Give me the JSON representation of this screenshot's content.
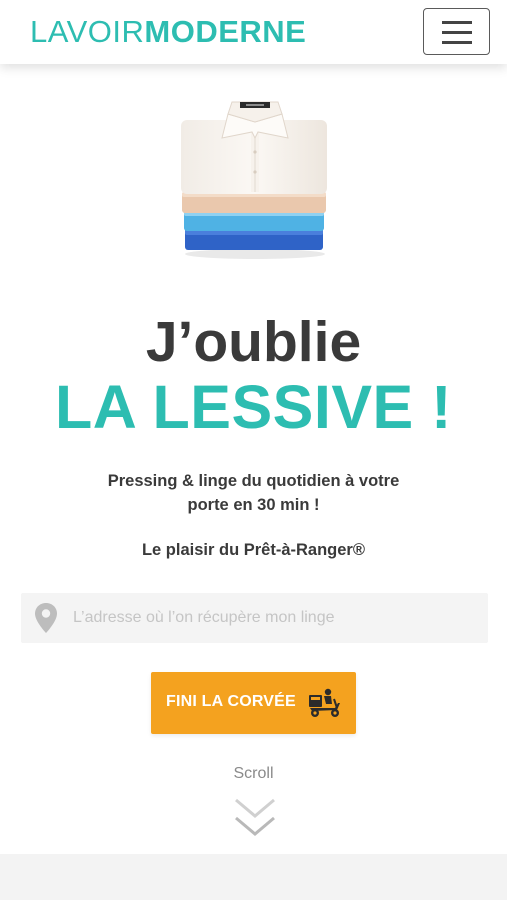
{
  "brand": {
    "logo_light": "LAVOIR",
    "logo_bold": "MODERNE",
    "accent_color": "#2dbdb1",
    "cta_color": "#f4a21f"
  },
  "header": {
    "menu_icon": "hamburger-menu-icon"
  },
  "hero": {
    "image_icon": "folded-shirts-stack",
    "title_line1": "J’oublie",
    "title_line2": "LA LESSIVE !",
    "subtitle": "Pressing & linge du quotidien à votre porte en 30 min !",
    "tagline": "Le plaisir du Prêt-à-Ranger®"
  },
  "address": {
    "icon": "location-pin-icon",
    "placeholder": "L’adresse où l’on récupère mon linge",
    "value": ""
  },
  "cta": {
    "label": "FINI LA CORVÉE",
    "icon": "delivery-scooter-icon"
  },
  "scroll": {
    "label": "Scroll",
    "icon": "double-chevron-down-icon"
  }
}
